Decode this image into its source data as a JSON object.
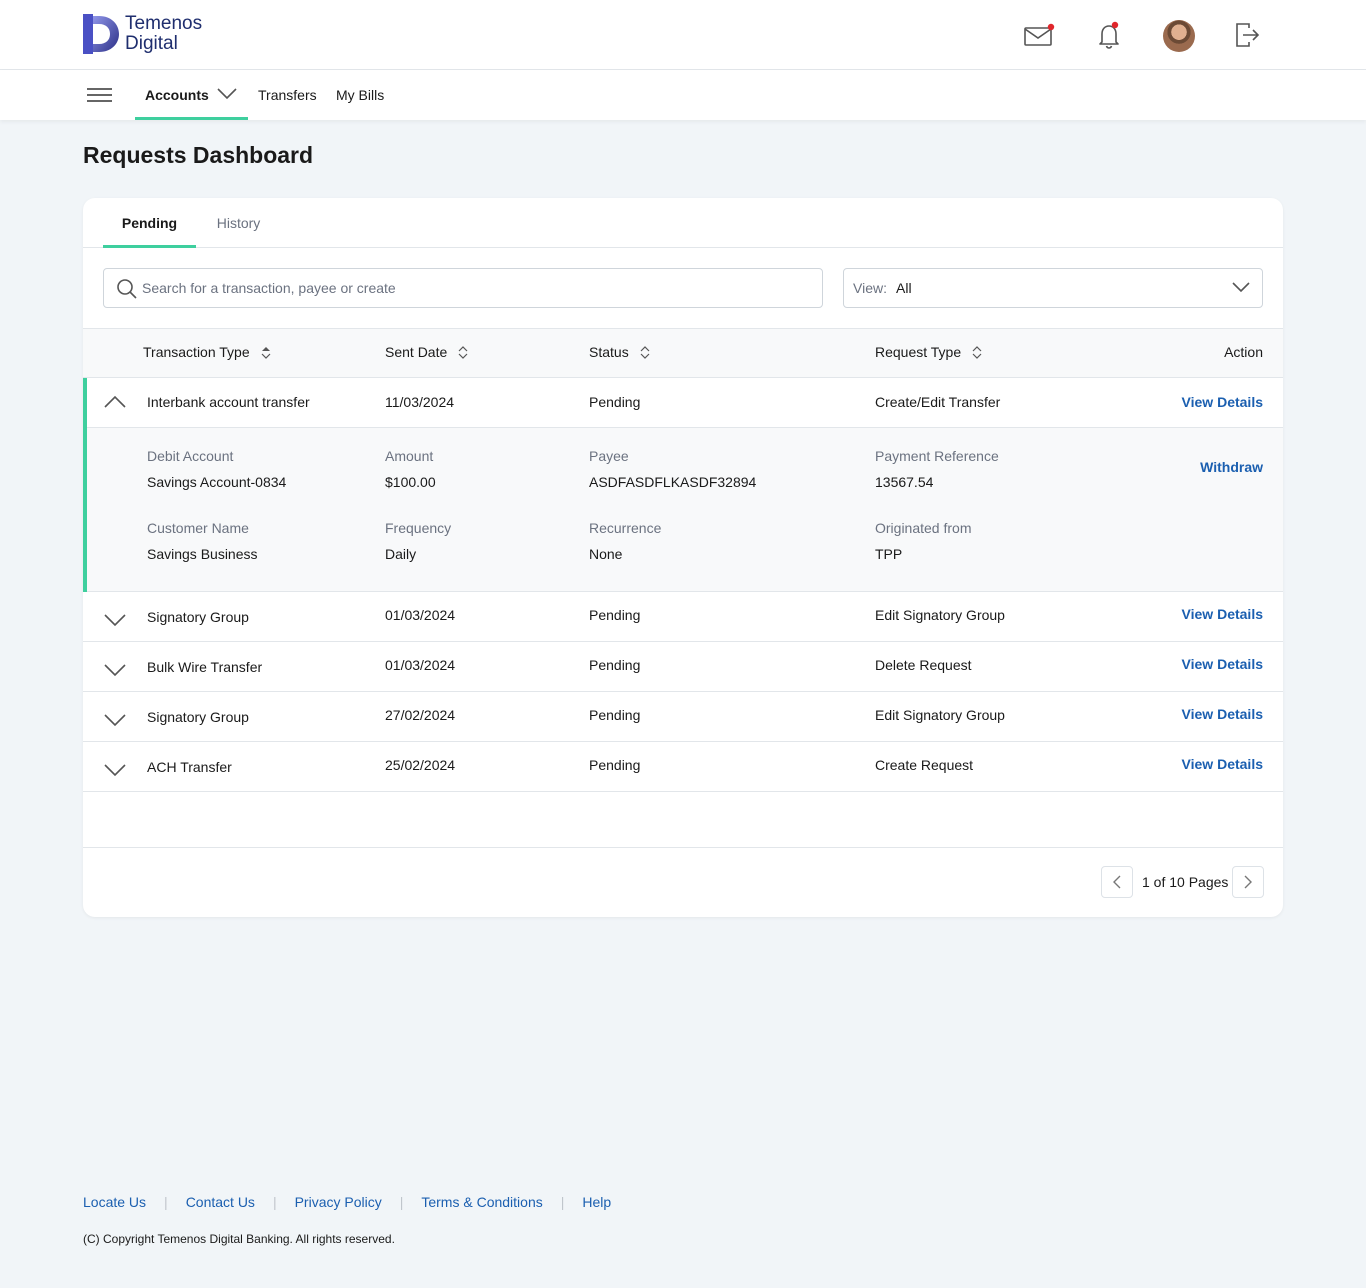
{
  "brand": {
    "line1": "Temenos",
    "line2": "Digital"
  },
  "header": {
    "icons": [
      "mail-icon",
      "bell-icon",
      "avatar",
      "logout-icon"
    ],
    "notification_color": "#e0262b"
  },
  "nav": {
    "accounts": "Accounts",
    "transfers": "Transfers",
    "bills": "My Bills"
  },
  "page": {
    "title": "Requests Dashboard"
  },
  "tabs": {
    "pending": "Pending",
    "history": "History"
  },
  "search": {
    "placeholder": "Search for a transaction, payee or create"
  },
  "view_filter": {
    "label": "View:",
    "value": "All"
  },
  "table": {
    "headers": {
      "transaction_type": "Transaction Type",
      "sent_date": "Sent Date",
      "status": "Status",
      "request_type": "Request Type",
      "action": "Action"
    },
    "rows": [
      {
        "type": "Interbank account transfer",
        "date": "11/03/2024",
        "status": "Pending",
        "request": "Create/Edit Transfer",
        "action": "View Details"
      },
      {
        "type": "Signatory Group",
        "date": "01/03/2024",
        "status": "Pending",
        "request": "Edit Signatory Group",
        "action": "View Details"
      },
      {
        "type": "Bulk Wire Transfer",
        "date": "01/03/2024",
        "status": "Pending",
        "request": "Delete Request",
        "action": "View Details"
      },
      {
        "type": "Signatory Group",
        "date": "27/02/2024",
        "status": "Pending",
        "request": "Edit Signatory Group",
        "action": "View Details"
      },
      {
        "type": "ACH Transfer",
        "date": "25/02/2024",
        "status": "Pending",
        "request": "Create Request",
        "action": "View Details"
      }
    ],
    "detail": {
      "debit_account_label": "Debit Account",
      "debit_account": "Savings Account-0834",
      "amount_label": "Amount",
      "amount": "$100.00",
      "payee_label": "Payee",
      "payee": "ASDFASDFLKASDF32894",
      "payment_ref_label": "Payment Reference",
      "payment_ref": "13567.54",
      "customer_label": "Customer Name",
      "customer": "Savings Business",
      "frequency_label": "Frequency",
      "frequency": "Daily",
      "recurrence_label": "Recurrence",
      "recurrence": "None",
      "origin_label": "Originated from",
      "origin": "TPP",
      "withdraw": "Withdraw"
    }
  },
  "pagination": {
    "text": "1 of 10 Pages"
  },
  "footer": {
    "links": [
      "Locate Us",
      "Contact Us",
      "Privacy Policy",
      "Terms & Conditions",
      "Help"
    ],
    "copyright": "(C) Copyright Temenos Digital Banking. All rights reserved."
  },
  "colors": {
    "accent": "#3ecf9e",
    "link": "#1b5fb0",
    "background": "#f1f5f8"
  }
}
